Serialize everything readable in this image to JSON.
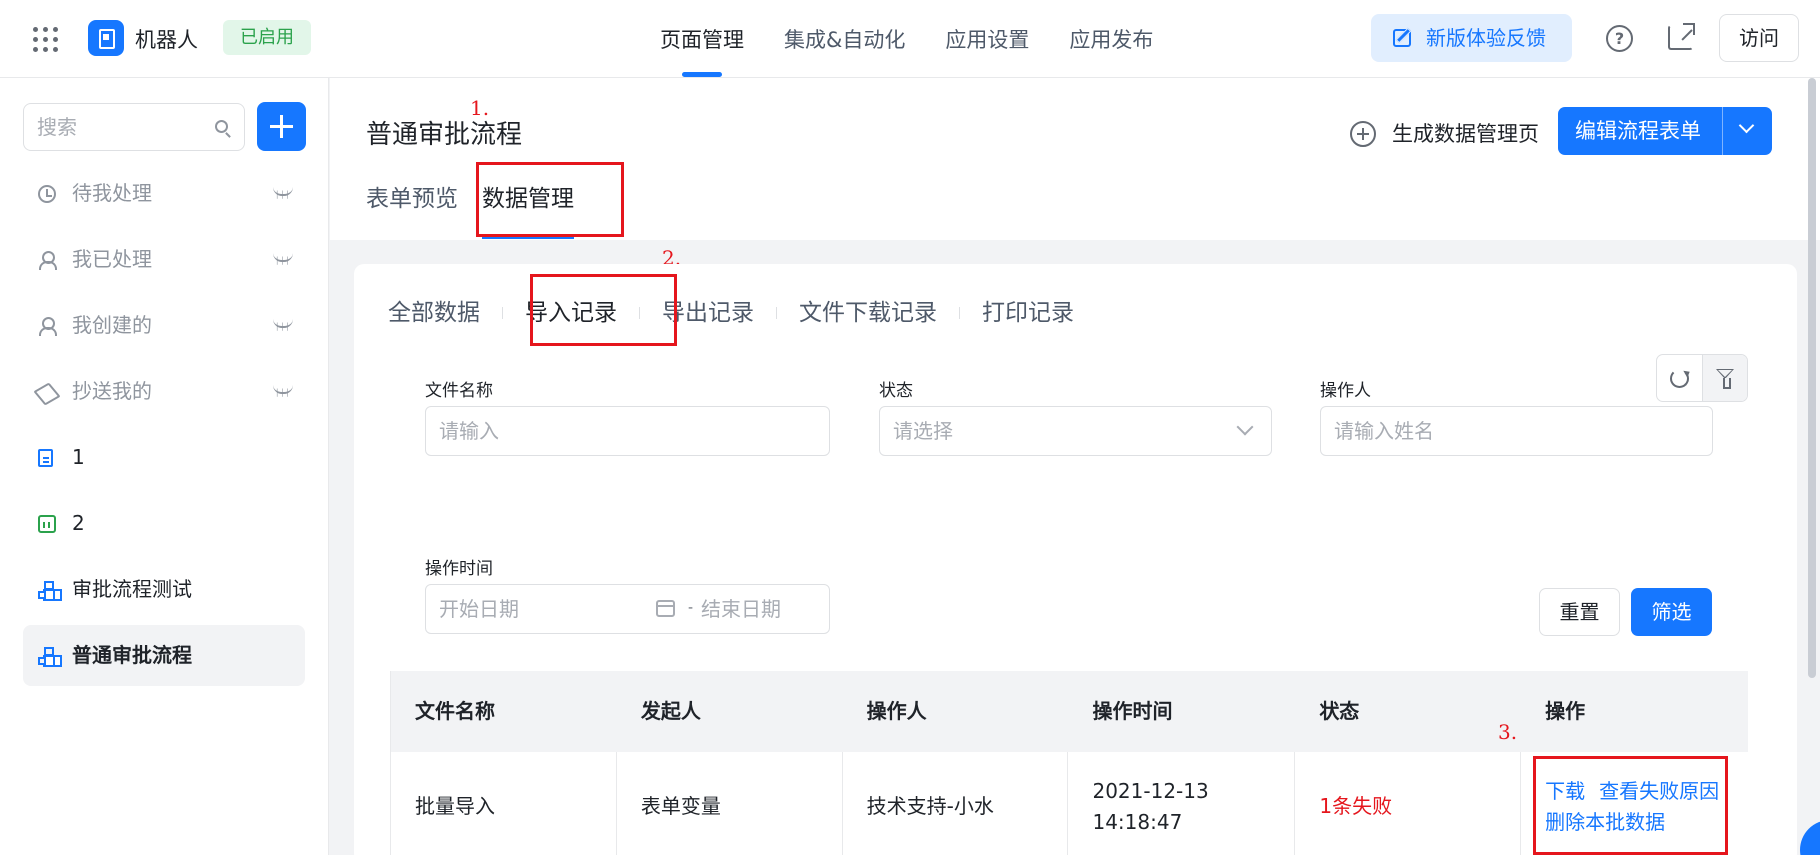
{
  "topbar": {
    "app_name": "机器人",
    "status_badge": "已启用",
    "nav": [
      "页面管理",
      "集成&自动化",
      "应用设置",
      "应用发布"
    ],
    "nav_active": "页面管理",
    "feedback_label": "新版体验反馈",
    "help_label": "?",
    "visit_label": "访问"
  },
  "sidebar": {
    "search_placeholder": "搜索",
    "items": [
      {
        "label": "待我处理",
        "icon": "clock-icon",
        "hidden": true
      },
      {
        "label": "我已处理",
        "icon": "user-check-icon",
        "hidden": true
      },
      {
        "label": "我创建的",
        "icon": "user-share-icon",
        "hidden": true
      },
      {
        "label": "抄送我的",
        "icon": "send-icon",
        "hidden": true
      },
      {
        "label": "1",
        "icon": "document-icon",
        "hidden": false
      },
      {
        "label": "2",
        "icon": "robot-icon",
        "hidden": false
      },
      {
        "label": "审批流程测试",
        "icon": "flow-icon",
        "hidden": false
      },
      {
        "label": "普通审批流程",
        "icon": "flow-icon",
        "hidden": false,
        "active": true
      }
    ]
  },
  "header": {
    "title": "普通审批流程",
    "generate_label": "生成数据管理页",
    "edit_label": "编辑流程表单",
    "tabs": [
      "表单预览",
      "数据管理"
    ],
    "active_tab": "数据管理"
  },
  "annotations": {
    "a1": "1.",
    "a2": "2.",
    "a3": "3."
  },
  "records": {
    "tabs": [
      "全部数据",
      "导入记录",
      "导出记录",
      "文件下载记录",
      "打印记录"
    ],
    "active_tab": "导入记录",
    "filters": {
      "file_name": {
        "label": "文件名称",
        "placeholder": "请输入"
      },
      "status": {
        "label": "状态",
        "placeholder": "请选择"
      },
      "operator": {
        "label": "操作人",
        "placeholder": "请输入姓名"
      },
      "time": {
        "label": "操作时间",
        "start_placeholder": "开始日期",
        "end_placeholder": "结束日期",
        "separator": "-"
      }
    },
    "reset_label": "重置",
    "filter_label": "筛选",
    "table": {
      "columns": [
        "文件名称",
        "发起人",
        "操作人",
        "操作时间",
        "状态",
        "操作"
      ],
      "rows": [
        {
          "file_name": "批量导入",
          "initiator": "表单变量",
          "operator": "技术支持-小水",
          "time": "2021-12-13 14:18:47",
          "status": "1条失败",
          "actions": [
            "下载",
            "查看失败原因",
            "删除本批数据"
          ]
        }
      ]
    }
  },
  "colors": {
    "primary": "#1677ff",
    "danger": "#e5161d",
    "success": "#2ba24c"
  }
}
